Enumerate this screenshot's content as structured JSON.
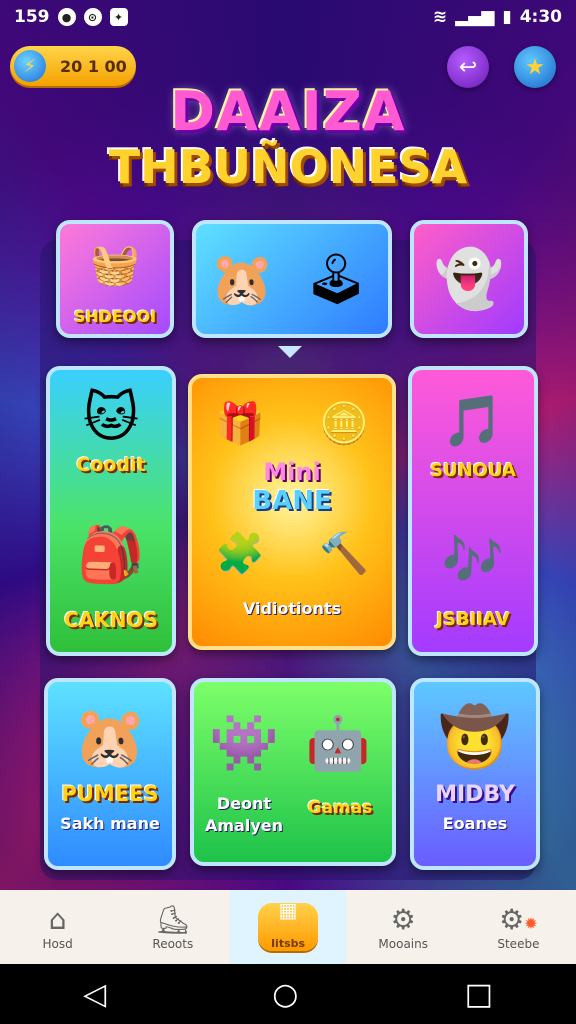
{
  "status_bar": {
    "left_text": "159",
    "left_icons": [
      "camera-icon",
      "app-icon",
      "notification-icon"
    ],
    "time": "4:30",
    "right_icons": [
      "wifi-icon",
      "signal-icon",
      "battery-icon"
    ]
  },
  "header": {
    "coin_value": "20 1 00",
    "title_line1": "DAAIZA",
    "title_line2": "THBUÑONESA"
  },
  "tiles": {
    "shop_label": "SHDEOOI",
    "left_top_label": "Coodit",
    "left_bottom_label": "CAKNOS",
    "center_title_1": "Mini",
    "center_title_2": "BANE",
    "center_subtitle": "Vidiotionts",
    "right_top_label": "SUNOUA",
    "right_bottom_label": "JSBIIAV",
    "bottom1_label": "PUMEES",
    "bottom1_sub": "Sakh mane",
    "bottom2_label_a": "Deont",
    "bottom2_label_a2": "Amalyen",
    "bottom2_label_b": "Gamas",
    "bottom3_label": "MIDBY",
    "bottom3_sub": "Eoanes"
  },
  "bottom_nav": {
    "items": [
      {
        "label": "Hosd",
        "icon": "home-icon"
      },
      {
        "label": "Reoots",
        "icon": "boot-icon"
      },
      {
        "label": "Iitsbs",
        "icon": "store-icon"
      },
      {
        "label": "Mooains",
        "icon": "gear-icon"
      },
      {
        "label": "Steebe",
        "icon": "gear-badge-icon"
      }
    ]
  },
  "colors": {
    "accent_orange": "#ffb000",
    "title_pink": "#ff5ad1",
    "title_yellow": "#ffd22e"
  }
}
